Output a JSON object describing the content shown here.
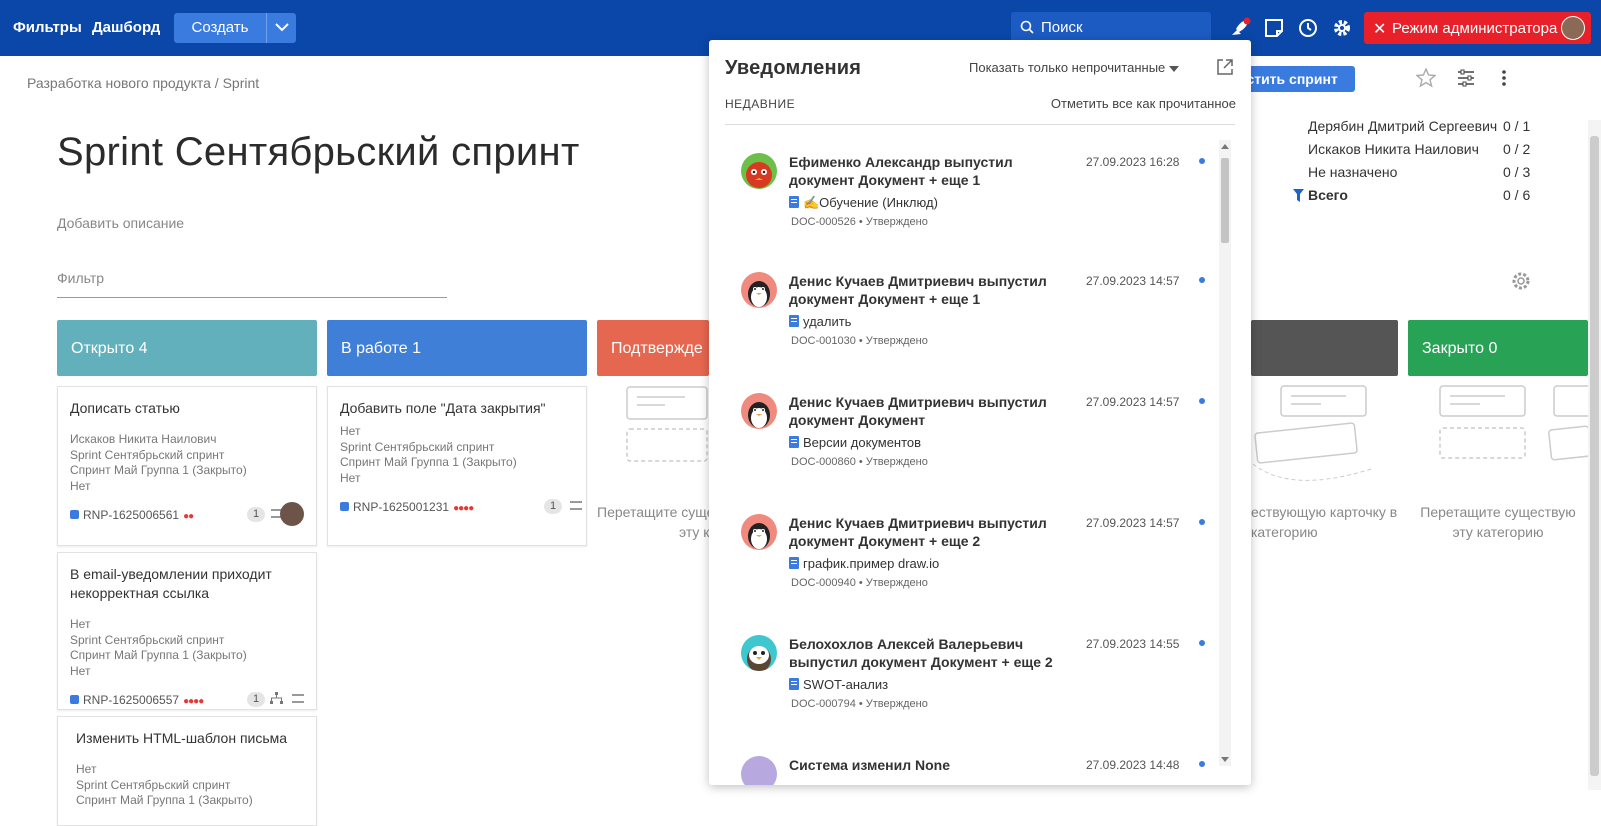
{
  "topbar": {
    "filters": "Фильтры",
    "dashboard": "Дашборд",
    "create": "Создать",
    "search": "Поиск",
    "admin_mode": "Режим администратора",
    "bg_color": "#0b47a8",
    "admin_color": "#e8202a"
  },
  "page": {
    "breadcrumb": "Разработка нового продукта / Sprint",
    "title": "Sprint Сентябрьский спринт",
    "add_description": "Добавить описание",
    "filter_placeholder": "Фильтр",
    "start_sprint": "устить спринт"
  },
  "stats": [
    {
      "name": "Дерябин Дмитрий Сергеевич",
      "value": "0 / 1"
    },
    {
      "name": "Искаков Никита Наилович",
      "value": "0 / 2"
    },
    {
      "name": "Не назначено",
      "value": "0 / 3"
    },
    {
      "name": "Всего",
      "value": "0 / 6"
    }
  ],
  "columns": [
    {
      "label": "Открыто 4",
      "color": "#62b0bb"
    },
    {
      "label": "В работе 1",
      "color": "#3f7fd8"
    },
    {
      "label": "Подтвержде",
      "color": "#e6674f"
    },
    {
      "label": "",
      "color": "#555555"
    },
    {
      "label": "Закрыто 0",
      "color": "#28a356"
    }
  ],
  "cards": [
    {
      "title": "Дописать статью",
      "meta": [
        "Искаков Никита Наилович",
        "Sprint Сентябрьский спринт",
        "Спринт Май Группа 1 (Закрыто)",
        "Нет"
      ],
      "id": "RNP-1625006561",
      "count": "1"
    },
    {
      "title": "В email-уведомлении приходит некорректная ссылка",
      "meta": [
        "Нет",
        "Sprint Сентябрьский спринт",
        "Спринт Май Группа 1 (Закрыто)",
        "Нет"
      ],
      "id": "RNP-1625006557",
      "count": "1"
    },
    {
      "title": "Изменить HTML-шаблон письма",
      "meta": [
        "Нет",
        "Sprint Сентябрьский спринт",
        "Спринт Май Группа 1 (Закрыто)"
      ]
    },
    {
      "title": "Добавить поле \"Дата закрытия\"",
      "meta": [
        "Нет",
        "Sprint Сентябрьский спринт",
        "Спринт Май Группа 1 (Закрыто)",
        "Нет"
      ],
      "id": "RNP-1625001231",
      "count": "1"
    }
  ],
  "empty_hints": {
    "col3": [
      "Перетащите сущес",
      "эту к"
    ],
    "col4": [
      "ествующую карточку в",
      "категорию"
    ],
    "col5": [
      "Перетащите существую",
      "эту категорию"
    ]
  },
  "notifications": {
    "title": "Уведомления",
    "show_unread": "Показать только непрочитанные",
    "recent": "НЕДАВНИЕ",
    "mark_all": "Отметить все как прочитанное",
    "items": [
      {
        "text": "Ефименко Александр выпустил документ Документ + еще 1",
        "time": "27.09.2023 16:28",
        "doc": "✍️Обучение (Инклюд)",
        "id": "DOC-000526 • Утверждено",
        "avatar": "red-bird"
      },
      {
        "text": "Денис Кучаев Дмитриевич выпустил документ Документ + еще 1",
        "time": "27.09.2023 14:57",
        "doc": "удалить",
        "id": "DOC-001030 • Утверждено",
        "avatar": "penguin"
      },
      {
        "text": "Денис Кучаев Дмитриевич выпустил документ Документ",
        "time": "27.09.2023 14:57",
        "doc": "Версии документов",
        "id": "DOC-000860 • Утверждено",
        "avatar": "penguin"
      },
      {
        "text": "Денис Кучаев Дмитриевич выпустил документ Документ + еще 2",
        "time": "27.09.2023 14:57",
        "doc": "график.пример draw.io",
        "id": "DOC-000940 • Утверждено",
        "avatar": "penguin"
      },
      {
        "text": "Белохохлов Алексей Валерьевич выпустил документ Документ + еще 2",
        "time": "27.09.2023 14:55",
        "doc": "SWOT-анализ",
        "id": "DOC-000794 • Утверждено",
        "avatar": "bird-teal"
      },
      {
        "text": "Система изменил None",
        "time": "27.09.2023 14:48",
        "doc": "",
        "id": "",
        "avatar": "purple"
      }
    ]
  }
}
